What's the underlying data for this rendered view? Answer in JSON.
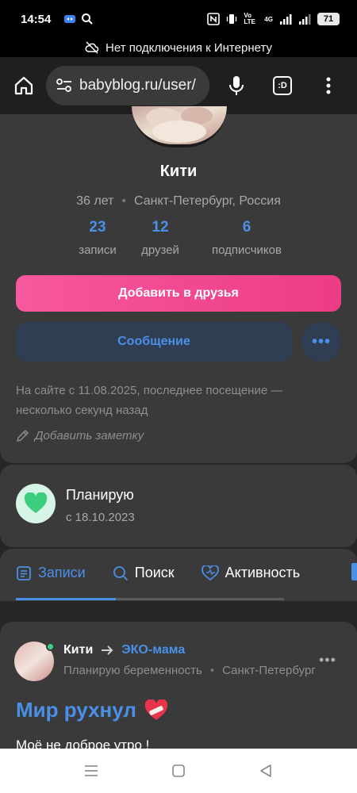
{
  "status_bar": {
    "time": "14:54",
    "battery": "71",
    "network": "Vo LTE",
    "net2": "4G"
  },
  "offline_banner": {
    "text": "Нет подключения к Интернету"
  },
  "browser": {
    "url": "babyblog.ru/user/",
    "tab_label": ":D"
  },
  "profile": {
    "name": "Кити",
    "age": "36 лет",
    "location": "Санкт-Петербург, Россия",
    "stats": [
      {
        "value": "23",
        "label": "записи"
      },
      {
        "value": "12",
        "label": "друзей"
      },
      {
        "value": "6",
        "label": "подписчиков"
      }
    ],
    "add_friend_label": "Добавить в друзья",
    "message_label": "Сообщение",
    "more_label": "•••",
    "since_text": "На сайте с 11.08.2025, последнее посещение — несколько секунд назад",
    "note_label": "Добавить заметку"
  },
  "planning": {
    "title": "Планирую",
    "date": "с 18.10.2023"
  },
  "tabs": [
    {
      "label": "Записи"
    },
    {
      "label": "Поиск"
    },
    {
      "label": "Активность"
    }
  ],
  "post": {
    "author": "Кити",
    "community": "ЭКО-мама",
    "status": "Планирую беременность",
    "location": "Санкт-Петербург",
    "title": "Мир рухнул",
    "text": "Моё не доброе утро !"
  },
  "colors": {
    "accent": "#4b90e8",
    "pink": "#f04a8e",
    "green": "#3cce7e"
  }
}
